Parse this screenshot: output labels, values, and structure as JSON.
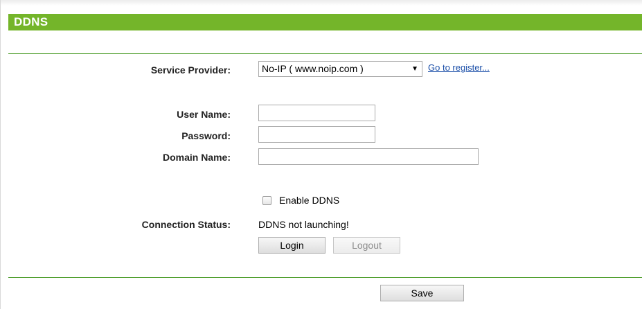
{
  "header": {
    "title": "DDNS"
  },
  "form": {
    "service_provider_label": "Service Provider:",
    "service_provider_value": "No-IP ( www.noip.com )",
    "register_link": "Go to register...",
    "username_label": "User Name:",
    "username_value": "",
    "password_label": "Password:",
    "password_value": "",
    "domain_label": "Domain Name:",
    "domain_value": "",
    "enable_label": "Enable DDNS",
    "enable_checked": false,
    "status_label": "Connection Status:",
    "status_value": "DDNS not launching!",
    "login_label": "Login",
    "logout_label": "Logout"
  },
  "footer": {
    "save_label": "Save"
  },
  "colors": {
    "header_bg": "#74b52a",
    "divider": "#4e9e2c",
    "link": "#1a4ea8"
  }
}
